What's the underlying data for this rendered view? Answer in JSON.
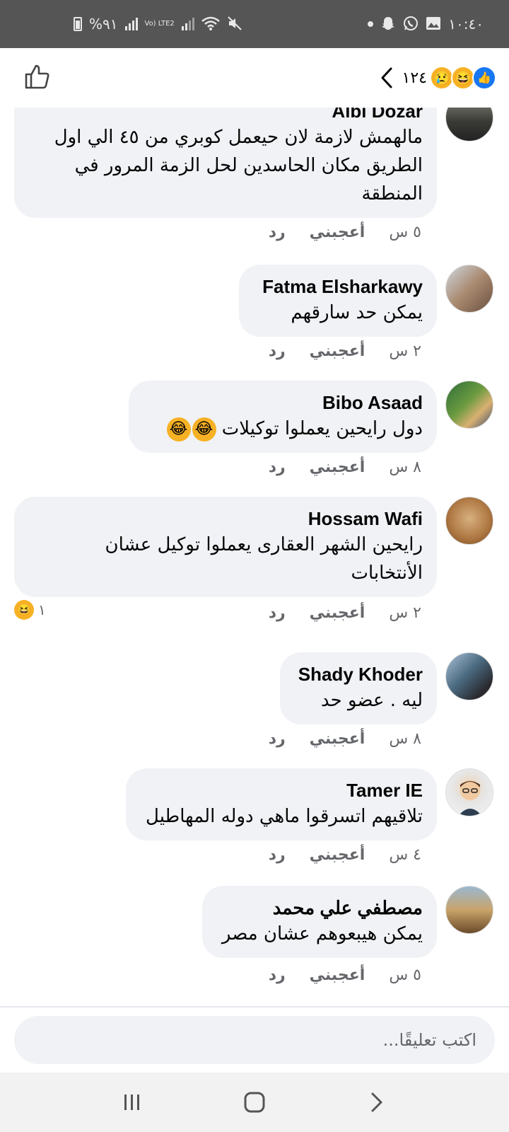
{
  "status_bar": {
    "time": "١٠:٤٠",
    "battery": "%٩١",
    "lte": "Vo) LTE2"
  },
  "header": {
    "reaction_count": "١٢٤",
    "reactions": [
      "like-icon",
      "haha-icon",
      "sad-icon"
    ]
  },
  "comments": [
    {
      "name": "Albi Dozar",
      "text": "مالهمش لازمة لان حيعمل كوبري من ٤٥ الي اول الطريق مكان الحاسدين لحل الزمة المرور في المنطقة",
      "time": "٥ س",
      "like": "أعجبني",
      "reply": "رد"
    },
    {
      "name": "Fatma Elsharkawy",
      "text": "يمكن حد سارقهم",
      "time": "٢ س",
      "like": "أعجبني",
      "reply": "رد"
    },
    {
      "name": "Bibo Asaad",
      "text": "دول رايحين يعملوا توكيلات",
      "time": "٨ س",
      "like": "أعجبني",
      "reply": "رد"
    },
    {
      "name": "Hossam Wafi",
      "text": "رايحين الشهر العقارى يعملوا توكيل عشان الأنتخابات",
      "time": "٢ س",
      "like": "أعجبني",
      "reply": "رد",
      "reaction_count": "١"
    },
    {
      "name": "Shady Khoder",
      "text": "ليه . عضو حد",
      "time": "٨ س",
      "like": "أعجبني",
      "reply": "رد"
    },
    {
      "name": "Tamer IE",
      "text": "تلاقيهم اتسرقوا ماهي دوله المهاطيل",
      "time": "٤ س",
      "like": "أعجبني",
      "reply": "رد"
    },
    {
      "name": "مصطفي علي محمد",
      "text": "يمكن هيبعوهم عشان مصر",
      "time": "٥ س",
      "like": "أعجبني",
      "reply": "رد"
    }
  ],
  "composer": {
    "placeholder": "اكتب تعليقًا..."
  },
  "colors": {
    "status_bar": "#555555",
    "bubble": "#f0f2f5",
    "meta_text": "#65676b",
    "like_blue": "#1877f2",
    "emoji_yellow": "#f7b125"
  }
}
